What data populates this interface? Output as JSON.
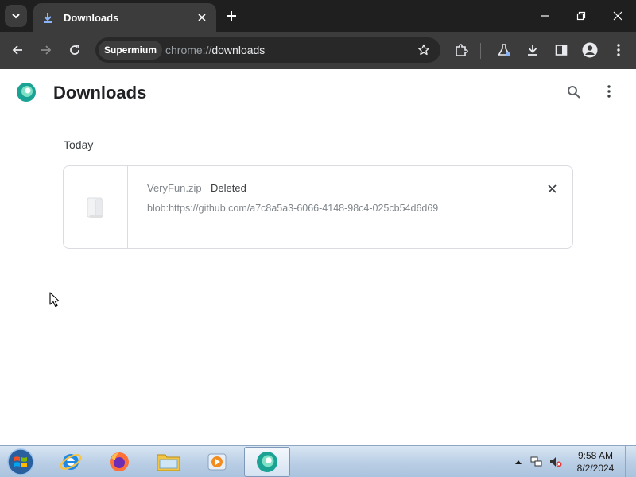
{
  "browser": {
    "tab": {
      "title": "Downloads"
    },
    "omnibox": {
      "chip_label": "Supermium",
      "url_scheme": "chrome://",
      "url_host": "downloads"
    }
  },
  "page": {
    "title": "Downloads",
    "section_date": "Today",
    "downloads": [
      {
        "file_name": "VeryFun.zip",
        "status": "Deleted",
        "url": "blob:https://github.com/a7c8a5a3-6066-4148-98c4-025cb54d6d69"
      }
    ]
  },
  "taskbar": {
    "time": "9:58 AM",
    "date": "8/2/2024"
  },
  "colors": {
    "tabstrip_bg": "#1f1f1f",
    "toolbar_bg": "#3c3c3c",
    "omnibox_bg": "#282828",
    "card_border": "#dadce0"
  }
}
